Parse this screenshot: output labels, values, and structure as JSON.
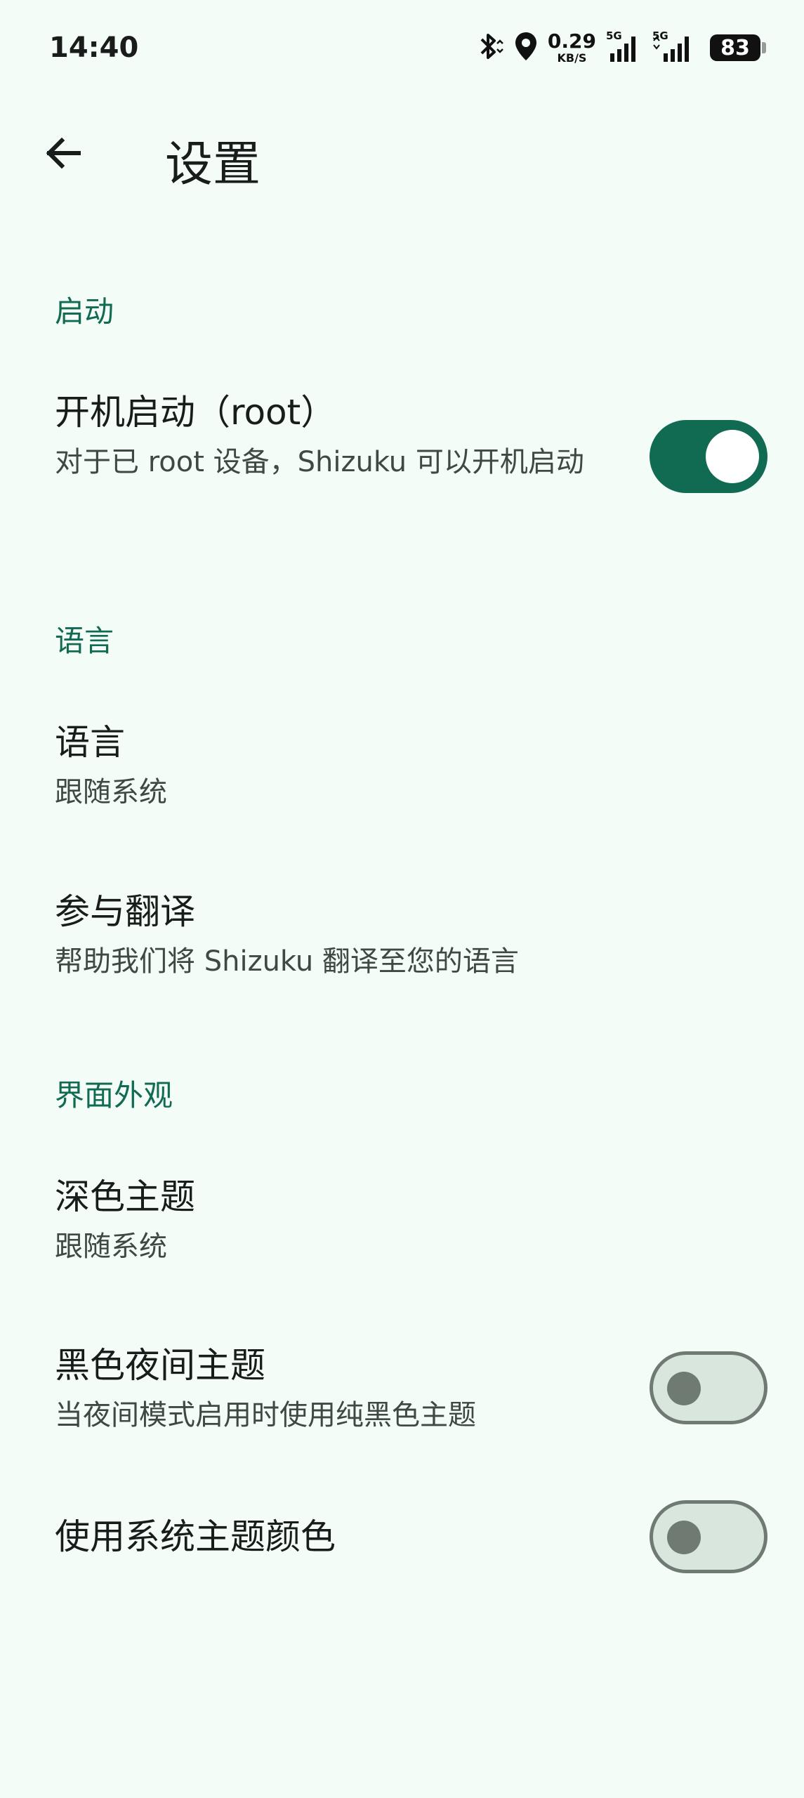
{
  "status_bar": {
    "time": "14:40",
    "net_speed_value": "0.29",
    "net_speed_unit": "KB/S",
    "signal_label_1": "5G",
    "signal_label_2": "5G",
    "battery": "83",
    "icons": [
      "bluetooth-icon",
      "location-icon",
      "signal-icon",
      "signal-icon",
      "battery-icon"
    ]
  },
  "app_bar": {
    "title": "设置",
    "back_icon": "arrow-back-icon"
  },
  "sections": {
    "startup": {
      "header": "启动",
      "boot": {
        "title": "开机启动（root）",
        "summary": "对于已 root 设备，Shizuku 可以开机启动",
        "checked": true
      }
    },
    "language": {
      "header": "语言",
      "language": {
        "title": "语言",
        "summary": "跟随系统"
      },
      "translate": {
        "title": "参与翻译",
        "summary": "帮助我们将 Shizuku 翻译至您的语言"
      }
    },
    "appearance": {
      "header": "界面外观",
      "dark_theme": {
        "title": "深色主题",
        "summary": "跟随系统"
      },
      "black_night": {
        "title": "黑色夜间主题",
        "summary": "当夜间模式启用时使用纯黑色主题",
        "checked": false
      },
      "system_color": {
        "title": "使用系统主题颜色",
        "checked": false
      }
    }
  },
  "colors": {
    "background": "#f3fcf6",
    "accent": "#116b52",
    "text_primary": "#181d1b",
    "text_secondary": "#3f4944",
    "switch_off_track": "#d8e6de",
    "switch_off_outline": "#6f7a73"
  }
}
